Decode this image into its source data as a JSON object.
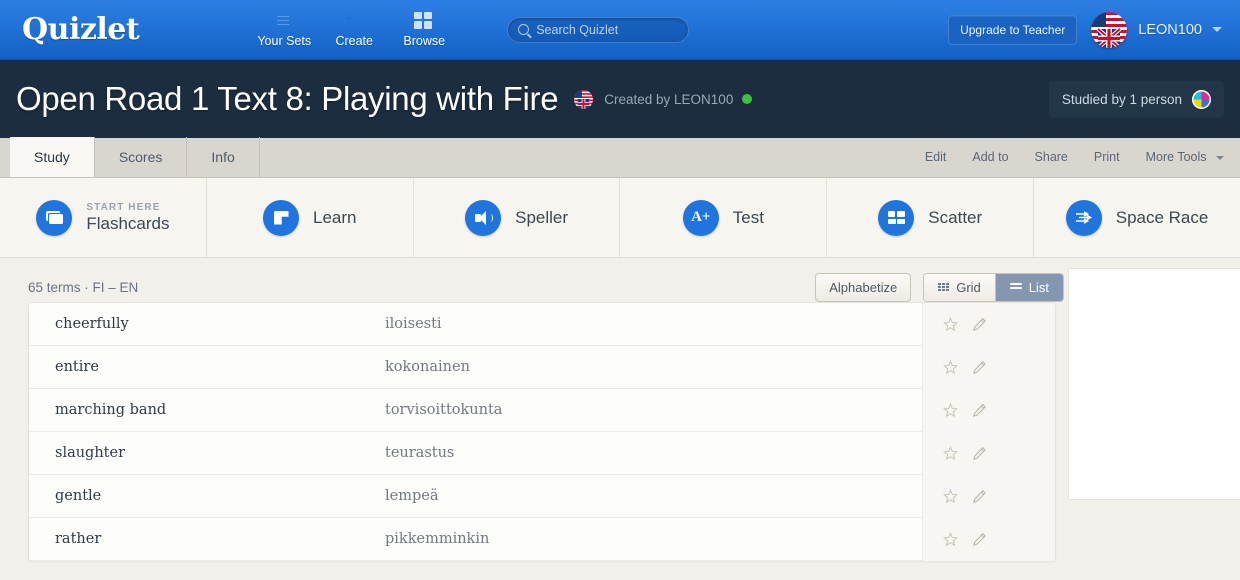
{
  "topnav": {
    "brand": "Quizlet",
    "items": [
      {
        "label": "Your Sets",
        "icon": "folder-icon"
      },
      {
        "label": "Create",
        "icon": "create-icon"
      },
      {
        "label": "Browse",
        "icon": "grid-icon"
      }
    ],
    "search": {
      "value": "",
      "placeholder": "Search Quizlet",
      "icon": "search-icon"
    },
    "upgrade_label": "Upgrade to Teacher",
    "username": "LEON100",
    "avatar_icon": "flag-avatar",
    "caret_icon": "chevron-down-icon",
    "accent_blue": "#1f6fd4"
  },
  "titlebar": {
    "title": "Open Road 1 Text 8: Playing with Fire",
    "flag_icon": "flag-icon",
    "created_by": "Created by LEON100",
    "status_icon": "online-dot-icon",
    "studied_badge": "Studied by 1 person",
    "pie_icon": "pie-chart-icon",
    "background": "#1c2d3f"
  },
  "tabbar": {
    "tabs": [
      {
        "label": "Study",
        "active": true
      },
      {
        "label": "Scores",
        "active": false
      },
      {
        "label": "Info",
        "active": false
      }
    ],
    "tools": [
      {
        "label": "Edit"
      },
      {
        "label": "Add to"
      },
      {
        "label": "Share"
      },
      {
        "label": "Print"
      },
      {
        "label": "More Tools"
      }
    ],
    "more_caret_icon": "chevron-down-icon"
  },
  "modebar": {
    "modes": [
      {
        "label": "Flashcards",
        "eyebrow": "START HERE",
        "icon": "flashcards-icon"
      },
      {
        "label": "Learn",
        "eyebrow": "",
        "icon": "learn-icon"
      },
      {
        "label": "Speller",
        "eyebrow": "",
        "icon": "speaker-icon"
      },
      {
        "label": "Test",
        "eyebrow": "",
        "icon": "a-plus-icon"
      },
      {
        "label": "Scatter",
        "eyebrow": "",
        "icon": "scatter-icon"
      },
      {
        "label": "Space Race",
        "eyebrow": "",
        "icon": "space-race-icon"
      }
    ],
    "circle_color": "#1f74dd"
  },
  "listhead": {
    "terms_meta": "65 terms · FI – EN",
    "alphabetize_label": "Alphabetize",
    "grid_label": "Grid",
    "list_label": "List",
    "grid_icon": "grid-dots-icon",
    "list_icon": "list-lines-icon",
    "active_view": "List"
  },
  "terms": [
    {
      "word": "cheerfully",
      "definition": "iloisesti"
    },
    {
      "word": "entire",
      "definition": "kokonainen"
    },
    {
      "word": "marching band",
      "definition": "torvisoittokunta"
    },
    {
      "word": "slaughter",
      "definition": "teurastus"
    },
    {
      "word": "gentle",
      "definition": "lempeä"
    },
    {
      "word": "rather",
      "definition": "pikkemminkin"
    }
  ],
  "row_icons": {
    "star": "star-outline-icon",
    "edit": "pencil-icon"
  }
}
